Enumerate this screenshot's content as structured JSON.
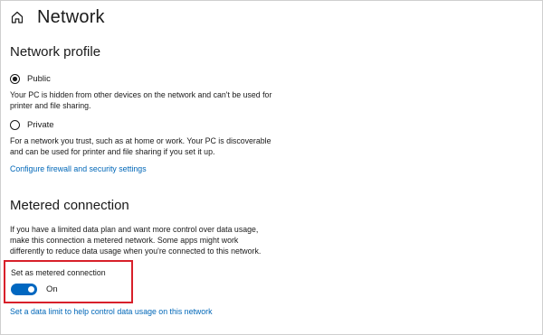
{
  "header": {
    "title": "Network"
  },
  "network_profile": {
    "title": "Network profile",
    "public": {
      "label": "Public",
      "selected": true,
      "description": "Your PC is hidden from other devices on the network and can't be used for printer and file sharing."
    },
    "private": {
      "label": "Private",
      "selected": false,
      "description": "For a network you trust, such as at home or work. Your PC is discoverable and can be used for printer and file sharing if you set it up."
    },
    "firewall_link": "Configure firewall and security settings"
  },
  "metered": {
    "title": "Metered connection",
    "description": "If you have a limited data plan and want more control over data usage, make this connection a metered network. Some apps might work differently to reduce data usage when you're connected to this network.",
    "toggle_label": "Set as metered connection",
    "toggle_state": "On",
    "toggle_on": true,
    "data_limit_link": "Set a data limit to help control data usage on this network"
  },
  "colors": {
    "accent": "#0067c0",
    "link": "#0067b8",
    "highlight": "#d8202a"
  },
  "icons": {
    "home": "home-icon"
  }
}
